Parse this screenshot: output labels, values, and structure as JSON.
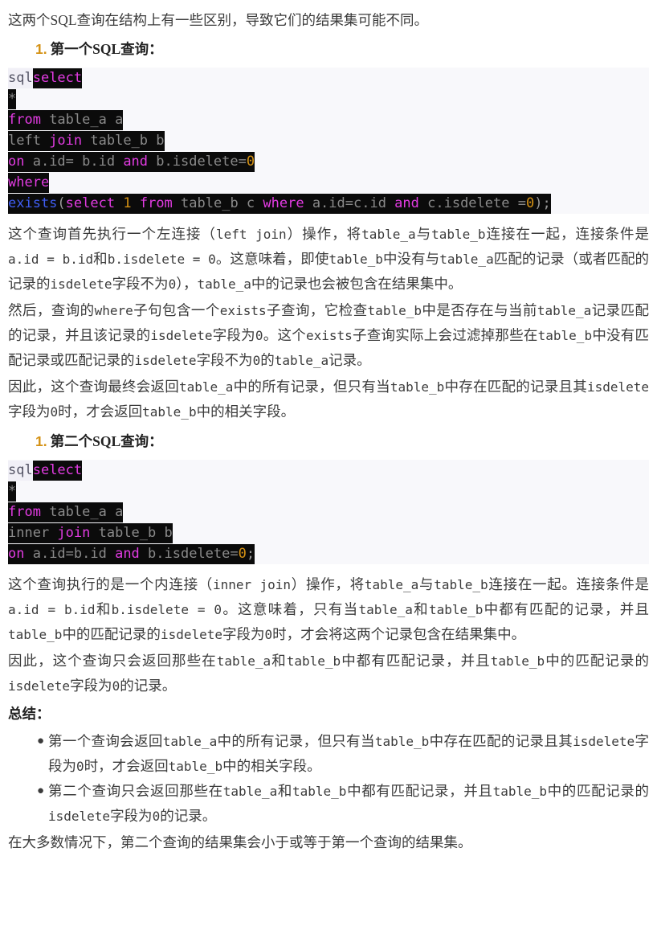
{
  "intro": {
    "text": "这两个SQL查询在结构上有一些区别，导致它们的结果集可能不同。"
  },
  "heading1": {
    "number": "1.",
    "text": "第一个SQL查询："
  },
  "heading2": {
    "number": "1.",
    "text": "第二个SQL查询："
  },
  "code_block_1": {
    "language_label": "sql",
    "lines": [
      [
        {
          "t": "select",
          "c": "kw"
        }
      ],
      [
        {
          "t": "*",
          "c": "star"
        }
      ],
      [
        {
          "t": "from",
          "c": "kw"
        },
        {
          "t": " table_a a",
          "c": "id"
        }
      ],
      [
        {
          "t": "left ",
          "c": "id"
        },
        {
          "t": "join",
          "c": "kw"
        },
        {
          "t": " table_b b",
          "c": "id"
        }
      ],
      [
        {
          "t": "on",
          "c": "kw"
        },
        {
          "t": " a.id= b.id ",
          "c": "id"
        },
        {
          "t": "and",
          "c": "kw"
        },
        {
          "t": " b.isdelete=",
          "c": "id"
        },
        {
          "t": "0",
          "c": "num"
        }
      ],
      [
        {
          "t": "where",
          "c": "kw"
        }
      ],
      [
        {
          "t": "exists",
          "c": "fn"
        },
        {
          "t": "(",
          "c": "punc"
        },
        {
          "t": "select",
          "c": "kw"
        },
        {
          "t": " ",
          "c": "id"
        },
        {
          "t": "1",
          "c": "num"
        },
        {
          "t": " ",
          "c": "id"
        },
        {
          "t": "from",
          "c": "kw"
        },
        {
          "t": " table_b c ",
          "c": "id"
        },
        {
          "t": "where",
          "c": "kw"
        },
        {
          "t": " a.id=c.id ",
          "c": "id"
        },
        {
          "t": "and",
          "c": "kw"
        },
        {
          "t": " c.isdelete =",
          "c": "id"
        },
        {
          "t": "0",
          "c": "num"
        },
        {
          "t": ");",
          "c": "punc"
        }
      ]
    ],
    "plain_text": "select\n*\nfrom table_a a\nleft join table_b b\non a.id= b.id and b.isdelete=0\nwhere\nexists(select 1 from table_b c where a.id=c.id and c.isdelete =0);"
  },
  "code_block_2": {
    "language_label": "sql",
    "lines": [
      [
        {
          "t": "select",
          "c": "kw"
        }
      ],
      [
        {
          "t": "*",
          "c": "star"
        }
      ],
      [
        {
          "t": "from",
          "c": "kw"
        },
        {
          "t": " table_a a",
          "c": "id"
        }
      ],
      [
        {
          "t": "inner ",
          "c": "id"
        },
        {
          "t": "join",
          "c": "kw"
        },
        {
          "t": " table_b b",
          "c": "id"
        }
      ],
      [
        {
          "t": "on",
          "c": "kw"
        },
        {
          "t": " a.id=b.id ",
          "c": "id"
        },
        {
          "t": "and",
          "c": "kw"
        },
        {
          "t": " b.isdelete=",
          "c": "id"
        },
        {
          "t": "0",
          "c": "num"
        },
        {
          "t": ";",
          "c": "punc"
        }
      ]
    ],
    "plain_text": "select\n*\nfrom table_a a\ninner join table_b b\non a.id=b.id and b.isdelete=0;"
  },
  "paragraphs": {
    "p1": [
      {
        "t": "这个查询首先执行一个左连接（",
        "m": false
      },
      {
        "t": "left join",
        "m": true
      },
      {
        "t": "）操作，将",
        "m": false
      },
      {
        "t": "table_a",
        "m": true
      },
      {
        "t": "与",
        "m": false
      },
      {
        "t": "table_b",
        "m": true
      },
      {
        "t": "连接在一起，连接条件是",
        "m": false
      },
      {
        "t": "a.id = b.id",
        "m": true
      },
      {
        "t": "和",
        "m": false
      },
      {
        "t": "b.isdelete = 0",
        "m": true
      },
      {
        "t": "。这意味着，即使",
        "m": false
      },
      {
        "t": "table_b",
        "m": true
      },
      {
        "t": "中没有与",
        "m": false
      },
      {
        "t": "table_a",
        "m": true
      },
      {
        "t": "匹配的记录（或者匹配的记录的",
        "m": false
      },
      {
        "t": "isdelete",
        "m": true
      },
      {
        "t": "字段不为",
        "m": false
      },
      {
        "t": "0",
        "m": true
      },
      {
        "t": "），",
        "m": false
      },
      {
        "t": "table_a",
        "m": true
      },
      {
        "t": "中的记录也会被包含在结果集中。",
        "m": false
      }
    ],
    "p2": [
      {
        "t": "然后，查询的",
        "m": false
      },
      {
        "t": "where",
        "m": true
      },
      {
        "t": "子句包含一个",
        "m": false
      },
      {
        "t": "exists",
        "m": true
      },
      {
        "t": "子查询，它检查",
        "m": false
      },
      {
        "t": "table_b",
        "m": true
      },
      {
        "t": "中是否存在与当前",
        "m": false
      },
      {
        "t": "table_a",
        "m": true
      },
      {
        "t": "记录匹配的记录，并且该记录的",
        "m": false
      },
      {
        "t": "isdelete",
        "m": true
      },
      {
        "t": "字段为",
        "m": false
      },
      {
        "t": "0",
        "m": true
      },
      {
        "t": "。这个",
        "m": false
      },
      {
        "t": "exists",
        "m": true
      },
      {
        "t": "子查询实际上会过滤掉那些在",
        "m": false
      },
      {
        "t": "table_b",
        "m": true
      },
      {
        "t": "中没有匹配记录或匹配记录的",
        "m": false
      },
      {
        "t": "isdelete",
        "m": true
      },
      {
        "t": "字段不为",
        "m": false
      },
      {
        "t": "0",
        "m": true
      },
      {
        "t": "的",
        "m": false
      },
      {
        "t": "table_a",
        "m": true
      },
      {
        "t": "记录。",
        "m": false
      }
    ],
    "p3": [
      {
        "t": "因此，这个查询最终会返回",
        "m": false
      },
      {
        "t": "table_a",
        "m": true
      },
      {
        "t": "中的所有记录，但只有当",
        "m": false
      },
      {
        "t": "table_b",
        "m": true
      },
      {
        "t": "中存在匹配的记录且其",
        "m": false
      },
      {
        "t": "isdelete",
        "m": true
      },
      {
        "t": "字段为",
        "m": false
      },
      {
        "t": "0",
        "m": true
      },
      {
        "t": "时，才会返回",
        "m": false
      },
      {
        "t": "table_b",
        "m": true
      },
      {
        "t": "中的相关字段。",
        "m": false
      }
    ],
    "p4": [
      {
        "t": "这个查询执行的是一个内连接（",
        "m": false
      },
      {
        "t": "inner join",
        "m": true
      },
      {
        "t": "）操作，将",
        "m": false
      },
      {
        "t": "table_a",
        "m": true
      },
      {
        "t": "与",
        "m": false
      },
      {
        "t": "table_b",
        "m": true
      },
      {
        "t": "连接在一起。连接条件是",
        "m": false
      },
      {
        "t": "a.id = b.id",
        "m": true
      },
      {
        "t": "和",
        "m": false
      },
      {
        "t": "b.isdelete = 0",
        "m": true
      },
      {
        "t": "。这意味着，只有当",
        "m": false
      },
      {
        "t": "table_a",
        "m": true
      },
      {
        "t": "和",
        "m": false
      },
      {
        "t": "table_b",
        "m": true
      },
      {
        "t": "中都有匹配的记录，并且",
        "m": false
      },
      {
        "t": "table_b",
        "m": true
      },
      {
        "t": "中的匹配记录的",
        "m": false
      },
      {
        "t": "isdelete",
        "m": true
      },
      {
        "t": "字段为",
        "m": false
      },
      {
        "t": "0",
        "m": true
      },
      {
        "t": "时，才会将这两个记录包含在结果集中。",
        "m": false
      }
    ],
    "p5": [
      {
        "t": "因此，这个查询只会返回那些在",
        "m": false
      },
      {
        "t": "table_a",
        "m": true
      },
      {
        "t": "和",
        "m": false
      },
      {
        "t": "table_b",
        "m": true
      },
      {
        "t": "中都有匹配记录，并且",
        "m": false
      },
      {
        "t": "table_b",
        "m": true
      },
      {
        "t": "中的匹配记录的",
        "m": false
      },
      {
        "t": "isdelete",
        "m": true
      },
      {
        "t": "字段为",
        "m": false
      },
      {
        "t": "0",
        "m": true
      },
      {
        "t": "的记录。",
        "m": false
      }
    ],
    "p6": [
      {
        "t": "在大多数情况下，第二个查询的结果集会小于或等于第一个查询的结果集。",
        "m": false
      }
    ]
  },
  "summary": {
    "label": "总结：",
    "bullet_marker": "●",
    "items": [
      [
        {
          "t": "第一个查询会返回",
          "m": false
        },
        {
          "t": "table_a",
          "m": true
        },
        {
          "t": "中的所有记录，但只有当",
          "m": false
        },
        {
          "t": "table_b",
          "m": true
        },
        {
          "t": "中存在匹配的记录且其",
          "m": false
        },
        {
          "t": "isdelete",
          "m": true
        },
        {
          "t": "字段为",
          "m": false
        },
        {
          "t": "0",
          "m": true
        },
        {
          "t": "时，才会返回",
          "m": false
        },
        {
          "t": "table_b",
          "m": true
        },
        {
          "t": "中的相关字段。",
          "m": false
        }
      ],
      [
        {
          "t": "第二个查询只会返回那些在",
          "m": false
        },
        {
          "t": "table_a",
          "m": true
        },
        {
          "t": "和",
          "m": false
        },
        {
          "t": "table_b",
          "m": true
        },
        {
          "t": "中都有匹配记录，并且",
          "m": false
        },
        {
          "t": "table_b",
          "m": true
        },
        {
          "t": "中的匹配记录的",
          "m": false
        },
        {
          "t": "isdelete",
          "m": true
        },
        {
          "t": "字段为",
          "m": false
        },
        {
          "t": "0",
          "m": true
        },
        {
          "t": "的记录。",
          "m": false
        }
      ]
    ]
  },
  "colors": {
    "page_background": "#ffffff",
    "text": "#3b3b3b",
    "code_background": "#f8f8fb",
    "code_line_highlight": "#0b0b0b",
    "keyword": "#e23be2",
    "identifier": "#8a8a8a",
    "number": "#d49114",
    "function": "#3f5df2",
    "lang_tag_background": "#f1f0f7"
  }
}
